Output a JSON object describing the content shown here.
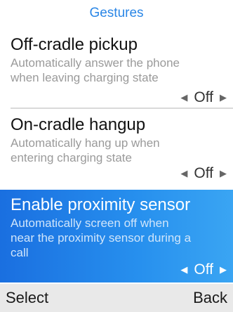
{
  "header": {
    "title": "Gestures"
  },
  "items": [
    {
      "title": "Off-cradle pickup",
      "desc_line1": "Automatically answer the phone",
      "desc_line2": "when leaving charging state",
      "value": "Off"
    },
    {
      "title": "On-cradle hangup",
      "desc_line1": "Automatically hang up when",
      "desc_line2": "entering charging state",
      "value": "Off"
    },
    {
      "title": "Enable proximity sensor",
      "desc_line1": "Automatically screen off when",
      "desc_line2": "near the  proximity sensor during a",
      "desc_line3": "call",
      "value": "Off",
      "selected": true
    }
  ],
  "icons": {
    "prev": "triangle-left-icon",
    "next": "triangle-right-icon"
  },
  "colors": {
    "accent": "#2a86e6",
    "selected_start": "#1a6fe0",
    "selected_end": "#3aa5f3",
    "softkey_bar": "#e9e9e9"
  },
  "softkeys": {
    "left": "Select",
    "right": "Back"
  }
}
